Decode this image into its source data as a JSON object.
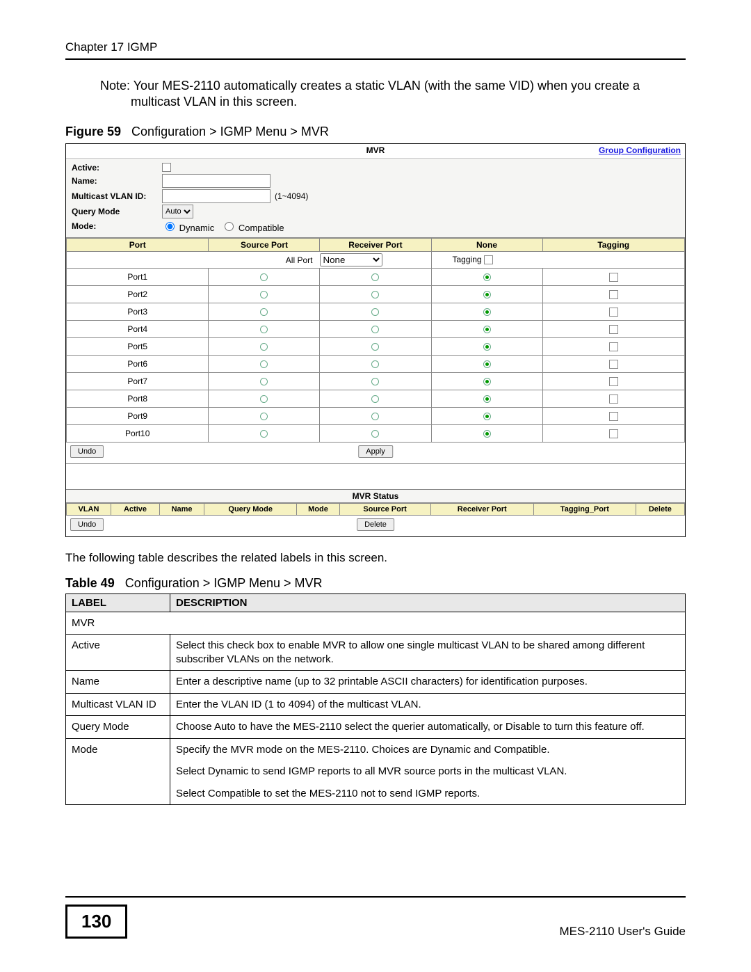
{
  "header": {
    "chapter": "Chapter 17 IGMP"
  },
  "note": "Note: Your MES-2110 automatically creates a static VLAN (with the same VID) when you create a multicast VLAN in this screen.",
  "figure": {
    "label": "Figure 59",
    "caption": "Configuration > IGMP Menu > MVR"
  },
  "mvr": {
    "title": "MVR",
    "link": "Group Configuration",
    "fields": {
      "active": "Active:",
      "name": "Name:",
      "vlanid": "Multicast VLAN ID:",
      "vlan_hint": "(1~4094)",
      "query": "Query Mode",
      "query_value": "Auto",
      "mode": "Mode:",
      "mode_opts": {
        "dynamic": "Dynamic",
        "compatible": "Compatible"
      }
    },
    "port_headers": [
      "Port",
      "Source Port",
      "Receiver Port",
      "None",
      "Tagging"
    ],
    "all_port": {
      "label": "All Port",
      "select": "None",
      "tagging": "Tagging"
    },
    "ports": [
      {
        "name": "Port1",
        "sel": "none"
      },
      {
        "name": "Port2",
        "sel": "none"
      },
      {
        "name": "Port3",
        "sel": "none"
      },
      {
        "name": "Port4",
        "sel": "none"
      },
      {
        "name": "Port5",
        "sel": "none"
      },
      {
        "name": "Port6",
        "sel": "none"
      },
      {
        "name": "Port7",
        "sel": "none"
      },
      {
        "name": "Port8",
        "sel": "none"
      },
      {
        "name": "Port9",
        "sel": "none"
      },
      {
        "name": "Port10",
        "sel": "none"
      }
    ],
    "buttons": {
      "undo": "Undo",
      "apply": "Apply",
      "delete": "Delete"
    },
    "status_title": "MVR Status",
    "status_headers": [
      "VLAN",
      "Active",
      "Name",
      "Query Mode",
      "Mode",
      "Source Port",
      "Receiver Port",
      "Tagging_Port",
      "Delete"
    ]
  },
  "following": "The following table describes the related labels in this screen.",
  "table": {
    "label": "Table 49",
    "caption": "Configuration > IGMP Menu > MVR",
    "head": {
      "c1": "LABEL",
      "c2": "DESCRIPTION"
    },
    "rows": [
      {
        "label": "MVR",
        "desc": "",
        "span": true
      },
      {
        "label": "Active",
        "desc": "Select this check box to enable MVR to allow one single multicast VLAN to be shared among different subscriber VLANs on the network."
      },
      {
        "label": "Name",
        "desc": "Enter a descriptive name (up to 32 printable ASCII characters) for identification purposes."
      },
      {
        "label": "Multicast VLAN ID",
        "desc": "Enter the VLAN ID (1 to 4094) of the multicast VLAN."
      },
      {
        "label": "Query Mode",
        "desc": "Choose Auto to have the MES-2110 select the querier automatically, or Disable to turn this feature off."
      },
      {
        "label": "Mode",
        "desc_multi": [
          "Specify the MVR mode on the MES-2110. Choices are Dynamic and Compatible.",
          "Select Dynamic to send IGMP reports to all MVR source ports in the multicast VLAN.",
          "Select Compatible to set the MES-2110 not to send IGMP reports."
        ]
      }
    ]
  },
  "footer": {
    "page": "130",
    "guide": "MES-2110 User's Guide"
  }
}
